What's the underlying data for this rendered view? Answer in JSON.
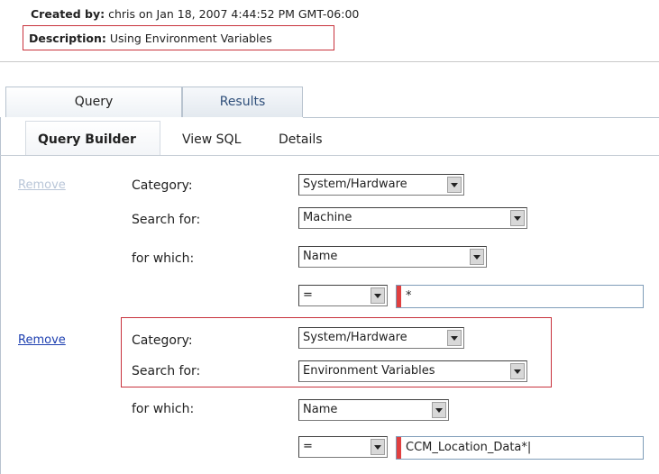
{
  "header": {
    "created_by_label": "Created by:",
    "created_by_value": "chris on Jan 18, 2007 4:44:52 PM GMT-06:00",
    "description_label": "Description:",
    "description_value": "Using Environment Variables"
  },
  "tabs": [
    {
      "label": "Query",
      "active": true
    },
    {
      "label": "Results",
      "active": false
    }
  ],
  "subtabs": [
    {
      "label": "Query Builder",
      "active": true
    },
    {
      "label": "View SQL",
      "active": false
    },
    {
      "label": "Details",
      "active": false
    }
  ],
  "criteria": [
    {
      "remove_label": "Remove",
      "remove_enabled": false,
      "category_label": "Category:",
      "category_value": "System/Hardware",
      "search_for_label": "Search for:",
      "search_for_value": "Machine",
      "for_which_label": "for which:",
      "for_which_value": "Name",
      "operator_value": "=",
      "text_value": "*"
    },
    {
      "remove_label": "Remove",
      "remove_enabled": true,
      "category_label": "Category:",
      "category_value": "System/Hardware",
      "search_for_label": "Search for:",
      "search_for_value": "Environment Variables",
      "for_which_label": "for which:",
      "for_which_value": "Name",
      "operator_value": "=",
      "text_value": "CCM_Location_Data*|"
    }
  ],
  "colors": {
    "highlight_box": "#c8323c",
    "link": "#1d3fb0",
    "link_disabled": "#b9c6d8",
    "required_marker": "#e04040"
  }
}
